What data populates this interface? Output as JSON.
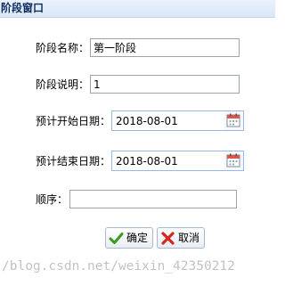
{
  "window": {
    "title": "阶段窗口"
  },
  "form": {
    "stage_name": {
      "label": "阶段名称：",
      "value": "第一阶段"
    },
    "stage_desc": {
      "label": "阶段说明：",
      "value": "1"
    },
    "start_date": {
      "label": "预计开始日期：",
      "value": "2018-08-01",
      "icon": "calendar-icon"
    },
    "end_date": {
      "label": "预计结束日期：",
      "value": "2018-08-01",
      "icon": "calendar-icon"
    },
    "order": {
      "label": "顺序：",
      "value": ""
    }
  },
  "buttons": {
    "ok": {
      "label": "确定",
      "icon": "checkmark-icon",
      "icon_color": "#3a9c1e"
    },
    "cancel": {
      "label": "取消",
      "icon": "cross-icon",
      "icon_color": "#d8261c"
    }
  },
  "watermark": "/blog.csdn.net/weixin_42350212"
}
